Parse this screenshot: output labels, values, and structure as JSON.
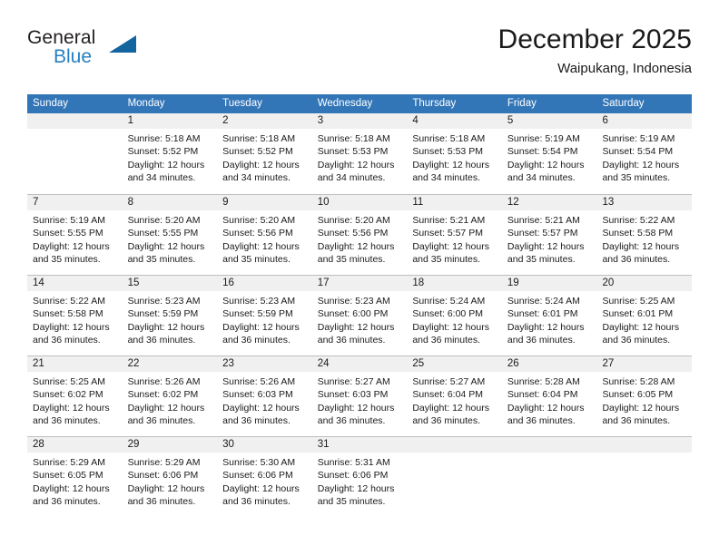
{
  "brand": {
    "name_top": "General",
    "name_bottom": "Blue",
    "accent_color": "#1464a0",
    "text_color": "#2580c3"
  },
  "header": {
    "title": "December 2025",
    "subtitle": "Waipukang, Indonesia"
  },
  "theme": {
    "header_bar_color": "#3376b8",
    "day_band_color": "#f0f0f0",
    "grid_line_color": "#bfbfbf"
  },
  "weekdays": [
    "Sunday",
    "Monday",
    "Tuesday",
    "Wednesday",
    "Thursday",
    "Friday",
    "Saturday"
  ],
  "weeks": [
    [
      {
        "day": "",
        "sunrise": "",
        "sunset": "",
        "daylight": ""
      },
      {
        "day": "1",
        "sunrise": "Sunrise: 5:18 AM",
        "sunset": "Sunset: 5:52 PM",
        "daylight": "Daylight: 12 hours and 34 minutes."
      },
      {
        "day": "2",
        "sunrise": "Sunrise: 5:18 AM",
        "sunset": "Sunset: 5:52 PM",
        "daylight": "Daylight: 12 hours and 34 minutes."
      },
      {
        "day": "3",
        "sunrise": "Sunrise: 5:18 AM",
        "sunset": "Sunset: 5:53 PM",
        "daylight": "Daylight: 12 hours and 34 minutes."
      },
      {
        "day": "4",
        "sunrise": "Sunrise: 5:18 AM",
        "sunset": "Sunset: 5:53 PM",
        "daylight": "Daylight: 12 hours and 34 minutes."
      },
      {
        "day": "5",
        "sunrise": "Sunrise: 5:19 AM",
        "sunset": "Sunset: 5:54 PM",
        "daylight": "Daylight: 12 hours and 34 minutes."
      },
      {
        "day": "6",
        "sunrise": "Sunrise: 5:19 AM",
        "sunset": "Sunset: 5:54 PM",
        "daylight": "Daylight: 12 hours and 35 minutes."
      }
    ],
    [
      {
        "day": "7",
        "sunrise": "Sunrise: 5:19 AM",
        "sunset": "Sunset: 5:55 PM",
        "daylight": "Daylight: 12 hours and 35 minutes."
      },
      {
        "day": "8",
        "sunrise": "Sunrise: 5:20 AM",
        "sunset": "Sunset: 5:55 PM",
        "daylight": "Daylight: 12 hours and 35 minutes."
      },
      {
        "day": "9",
        "sunrise": "Sunrise: 5:20 AM",
        "sunset": "Sunset: 5:56 PM",
        "daylight": "Daylight: 12 hours and 35 minutes."
      },
      {
        "day": "10",
        "sunrise": "Sunrise: 5:20 AM",
        "sunset": "Sunset: 5:56 PM",
        "daylight": "Daylight: 12 hours and 35 minutes."
      },
      {
        "day": "11",
        "sunrise": "Sunrise: 5:21 AM",
        "sunset": "Sunset: 5:57 PM",
        "daylight": "Daylight: 12 hours and 35 minutes."
      },
      {
        "day": "12",
        "sunrise": "Sunrise: 5:21 AM",
        "sunset": "Sunset: 5:57 PM",
        "daylight": "Daylight: 12 hours and 35 minutes."
      },
      {
        "day": "13",
        "sunrise": "Sunrise: 5:22 AM",
        "sunset": "Sunset: 5:58 PM",
        "daylight": "Daylight: 12 hours and 36 minutes."
      }
    ],
    [
      {
        "day": "14",
        "sunrise": "Sunrise: 5:22 AM",
        "sunset": "Sunset: 5:58 PM",
        "daylight": "Daylight: 12 hours and 36 minutes."
      },
      {
        "day": "15",
        "sunrise": "Sunrise: 5:23 AM",
        "sunset": "Sunset: 5:59 PM",
        "daylight": "Daylight: 12 hours and 36 minutes."
      },
      {
        "day": "16",
        "sunrise": "Sunrise: 5:23 AM",
        "sunset": "Sunset: 5:59 PM",
        "daylight": "Daylight: 12 hours and 36 minutes."
      },
      {
        "day": "17",
        "sunrise": "Sunrise: 5:23 AM",
        "sunset": "Sunset: 6:00 PM",
        "daylight": "Daylight: 12 hours and 36 minutes."
      },
      {
        "day": "18",
        "sunrise": "Sunrise: 5:24 AM",
        "sunset": "Sunset: 6:00 PM",
        "daylight": "Daylight: 12 hours and 36 minutes."
      },
      {
        "day": "19",
        "sunrise": "Sunrise: 5:24 AM",
        "sunset": "Sunset: 6:01 PM",
        "daylight": "Daylight: 12 hours and 36 minutes."
      },
      {
        "day": "20",
        "sunrise": "Sunrise: 5:25 AM",
        "sunset": "Sunset: 6:01 PM",
        "daylight": "Daylight: 12 hours and 36 minutes."
      }
    ],
    [
      {
        "day": "21",
        "sunrise": "Sunrise: 5:25 AM",
        "sunset": "Sunset: 6:02 PM",
        "daylight": "Daylight: 12 hours and 36 minutes."
      },
      {
        "day": "22",
        "sunrise": "Sunrise: 5:26 AM",
        "sunset": "Sunset: 6:02 PM",
        "daylight": "Daylight: 12 hours and 36 minutes."
      },
      {
        "day": "23",
        "sunrise": "Sunrise: 5:26 AM",
        "sunset": "Sunset: 6:03 PM",
        "daylight": "Daylight: 12 hours and 36 minutes."
      },
      {
        "day": "24",
        "sunrise": "Sunrise: 5:27 AM",
        "sunset": "Sunset: 6:03 PM",
        "daylight": "Daylight: 12 hours and 36 minutes."
      },
      {
        "day": "25",
        "sunrise": "Sunrise: 5:27 AM",
        "sunset": "Sunset: 6:04 PM",
        "daylight": "Daylight: 12 hours and 36 minutes."
      },
      {
        "day": "26",
        "sunrise": "Sunrise: 5:28 AM",
        "sunset": "Sunset: 6:04 PM",
        "daylight": "Daylight: 12 hours and 36 minutes."
      },
      {
        "day": "27",
        "sunrise": "Sunrise: 5:28 AM",
        "sunset": "Sunset: 6:05 PM",
        "daylight": "Daylight: 12 hours and 36 minutes."
      }
    ],
    [
      {
        "day": "28",
        "sunrise": "Sunrise: 5:29 AM",
        "sunset": "Sunset: 6:05 PM",
        "daylight": "Daylight: 12 hours and 36 minutes."
      },
      {
        "day": "29",
        "sunrise": "Sunrise: 5:29 AM",
        "sunset": "Sunset: 6:06 PM",
        "daylight": "Daylight: 12 hours and 36 minutes."
      },
      {
        "day": "30",
        "sunrise": "Sunrise: 5:30 AM",
        "sunset": "Sunset: 6:06 PM",
        "daylight": "Daylight: 12 hours and 36 minutes."
      },
      {
        "day": "31",
        "sunrise": "Sunrise: 5:31 AM",
        "sunset": "Sunset: 6:06 PM",
        "daylight": "Daylight: 12 hours and 35 minutes."
      },
      {
        "day": "",
        "sunrise": "",
        "sunset": "",
        "daylight": ""
      },
      {
        "day": "",
        "sunrise": "",
        "sunset": "",
        "daylight": ""
      },
      {
        "day": "",
        "sunrise": "",
        "sunset": "",
        "daylight": ""
      }
    ]
  ]
}
